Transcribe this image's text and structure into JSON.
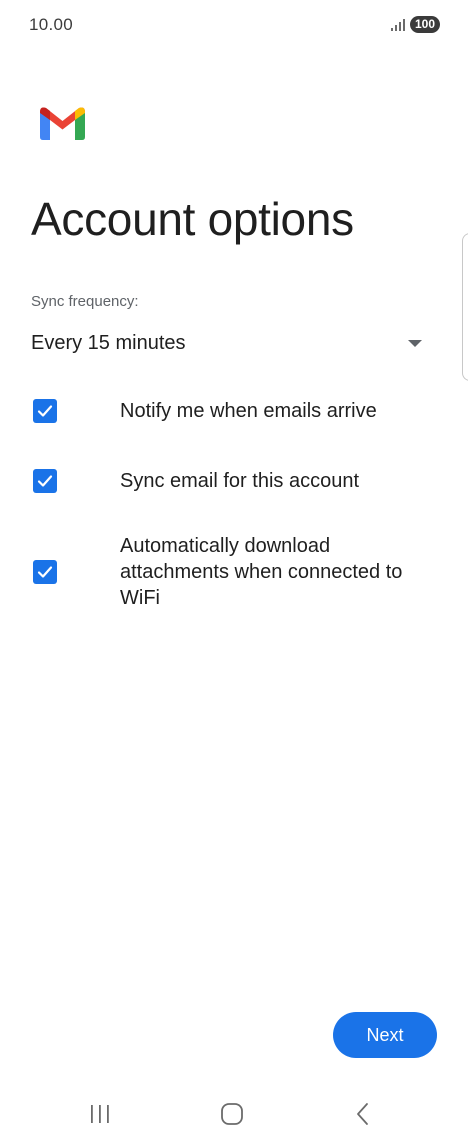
{
  "status_bar": {
    "time": "10.00",
    "battery": "100",
    "signal_icon": "signal-icon"
  },
  "app": {
    "logo_icon": "gmail-logo-icon",
    "colors": {
      "accent": "#1a73e8",
      "gmail_red": "#ea4335",
      "gmail_blue": "#4285f4",
      "gmail_green": "#34a853",
      "gmail_yellow": "#fbbc04"
    }
  },
  "page": {
    "title": "Account options"
  },
  "sync": {
    "label": "Sync frequency:",
    "selected": "Every 15 minutes"
  },
  "options": [
    {
      "label": "Notify me when emails arrive",
      "checked": true
    },
    {
      "label": "Sync email for this account",
      "checked": true
    },
    {
      "label": "Automatically download attachments when connected to WiFi",
      "checked": true
    }
  ],
  "actions": {
    "next_label": "Next"
  },
  "nav": {
    "recent_icon": "recent-apps-icon",
    "home_icon": "home-icon",
    "back_icon": "back-icon"
  }
}
